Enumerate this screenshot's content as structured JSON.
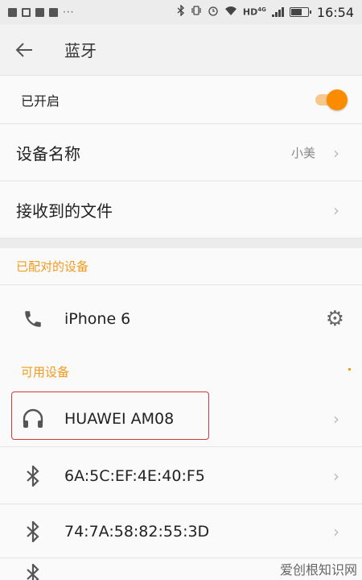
{
  "status_bar": {
    "time": "16:54",
    "network": "HD",
    "network_gen": "4G",
    "battery_level": 0.6,
    "notification_icons": [
      "app-icon",
      "image-icon",
      "app-icon",
      "app-icon"
    ],
    "more": "···"
  },
  "app_bar": {
    "title": "蓝牙",
    "back_icon": "back-arrow-icon"
  },
  "bluetooth_toggle": {
    "label": "已开启",
    "on": true,
    "accent": "#fb8c00"
  },
  "device_name": {
    "label": "设备名称",
    "value": "小美"
  },
  "received_files": {
    "label": "接收到的文件"
  },
  "paired": {
    "header": "已配对的设备",
    "devices": [
      {
        "name": "iPhone 6",
        "icon": "phone-icon"
      }
    ]
  },
  "available": {
    "header": "可用设备",
    "devices": [
      {
        "name": "HUAWEI AM08",
        "icon": "headphones-icon"
      },
      {
        "name": "6A:5C:EF:4E:40:F5",
        "icon": "bluetooth-icon"
      },
      {
        "name": "74:7A:58:82:55:3D",
        "icon": "bluetooth-icon"
      }
    ]
  },
  "watermark": "爱创根知识网"
}
